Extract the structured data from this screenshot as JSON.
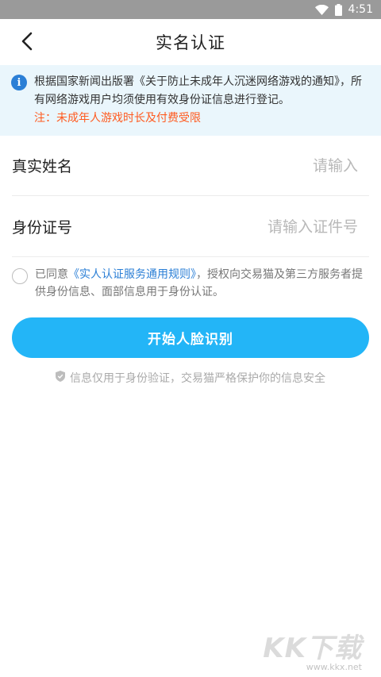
{
  "status_bar": {
    "time": "4:51"
  },
  "nav": {
    "title": "实名认证"
  },
  "notice": {
    "text": "根据国家新闻出版署《关于防止未成年人沉迷网络游戏的通知》，所有网络游戏用户均须使用有效身份证信息进行登记。",
    "warning": "注：未成年人游戏时长及付费受限"
  },
  "form": {
    "name_label": "真实姓名",
    "name_placeholder": "请输入",
    "id_label": "身份证号",
    "id_placeholder": "请输入证件号"
  },
  "agreement": {
    "prefix": "已同意",
    "link": "《实人认证服务通用规则》",
    "suffix": "，授权向交易猫及第三方服务者提供身份信息、面部信息用于身份认证。"
  },
  "start_button_label": "开始人脸识别",
  "security_note": "信息仅用于身份验证，交易猫严格保护你的信息安全",
  "watermark": {
    "main": "KK下载",
    "sub": "www.kkx.net"
  },
  "colors": {
    "accent": "#23b5f7",
    "link": "#2b7fd6",
    "warning": "#ff5a1f",
    "notice_bg": "#eaf6fc"
  }
}
